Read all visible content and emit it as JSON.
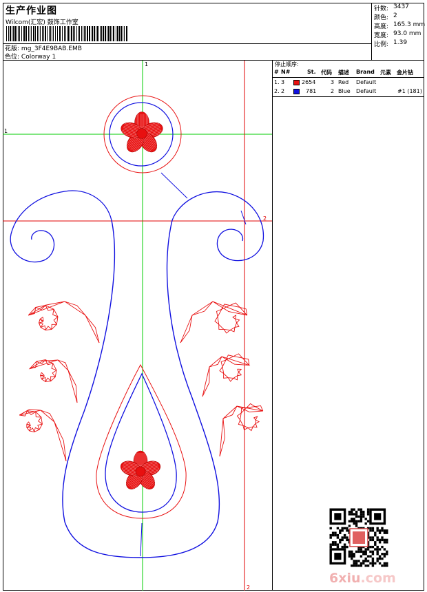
{
  "header": {
    "title": "生产作业图",
    "company": "Wilcom(汇宏) 鼓饰工作室",
    "file_label": "花版:",
    "file_name": "mg_3F4E9BAB.EMB",
    "colorway_label": "色位:",
    "colorway": "Colorway 1"
  },
  "stats": [
    {
      "label": "针数:",
      "value": "3437"
    },
    {
      "label": "颜色:",
      "value": "2"
    },
    {
      "label": "高度:",
      "value": "165.3 mm"
    },
    {
      "label": "宽度:",
      "value": "93.0 mm"
    },
    {
      "label": "比例:",
      "value": "1.39"
    }
  ],
  "guides": {
    "green_top": "1",
    "green_left": "1",
    "red_right": "2",
    "red_bottom": "2"
  },
  "stop_sequence": {
    "title": "停止顺序:",
    "columns": [
      "#",
      "N#",
      "St.",
      "代码",
      "描述",
      "Brand",
      "元素",
      "金片钻"
    ],
    "rows": [
      {
        "idx": "1.",
        "n": "3",
        "color": "#e81010",
        "stitches": "2654",
        "code": "3",
        "desc": "Red",
        "brand": "Default",
        "element": "",
        "sequin": ""
      },
      {
        "idx": "2.",
        "n": "2",
        "color": "#1010e0",
        "stitches": "781",
        "code": "2",
        "desc": "Blue",
        "brand": "Default",
        "element": "",
        "sequin": "#1 (181)"
      }
    ]
  },
  "watermark": {
    "text": "6xiu",
    "suffix": ".com"
  },
  "colors": {
    "thread_red": "#e81010",
    "thread_blue": "#1010e0",
    "guide_green": "#00cc00",
    "guide_red": "#e00000"
  }
}
